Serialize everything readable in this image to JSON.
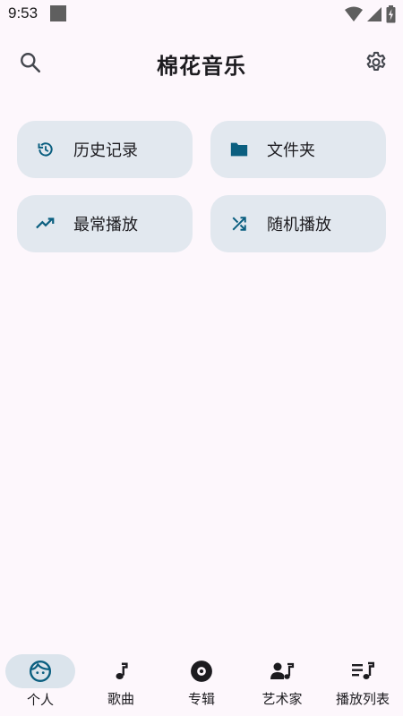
{
  "status_bar": {
    "time": "9:53",
    "icons": [
      "wifi-icon",
      "cellular-icon",
      "battery-charging-icon"
    ]
  },
  "app_bar": {
    "title": "棉花音乐",
    "search_icon": "search-icon",
    "settings_icon": "gear-icon"
  },
  "quick_actions": [
    {
      "label": "历史记录",
      "icon": "history-icon"
    },
    {
      "label": "文件夹",
      "icon": "folder-icon"
    },
    {
      "label": "最常播放",
      "icon": "trending-up-icon"
    },
    {
      "label": "随机播放",
      "icon": "shuffle-icon"
    }
  ],
  "bottom_nav": {
    "items": [
      {
        "label": "个人",
        "icon": "face-icon",
        "active": true
      },
      {
        "label": "歌曲",
        "icon": "music-note-icon",
        "active": false
      },
      {
        "label": "专辑",
        "icon": "album-icon",
        "active": false
      },
      {
        "label": "艺术家",
        "icon": "artist-icon",
        "active": false
      },
      {
        "label": "播放列表",
        "icon": "playlist-icon",
        "active": false
      }
    ]
  },
  "colors": {
    "background": "#fdf7fc",
    "tile": "#e2e8ef",
    "accent": "#0b5f80",
    "active_nav": "#dbe4ec",
    "icon": "#1c1b1f"
  }
}
